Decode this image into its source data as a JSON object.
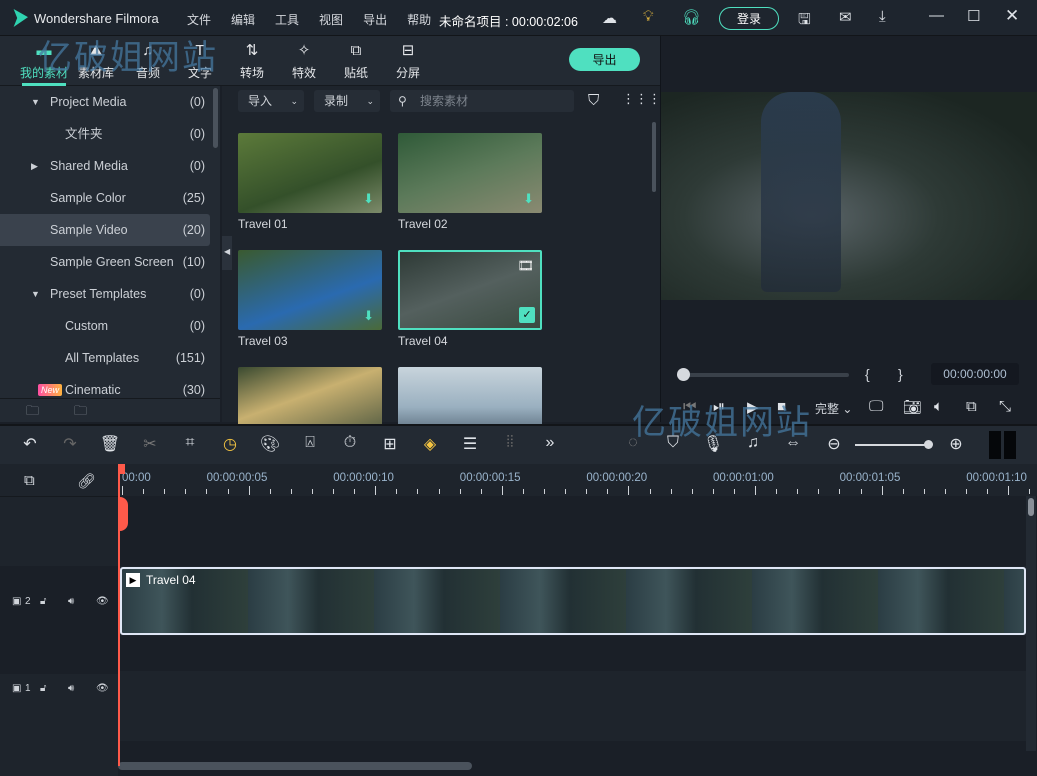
{
  "app": {
    "title": "Wondershare Filmora",
    "project": "未命名项目 : 00:00:02:06",
    "login": "登录"
  },
  "menu": [
    "文件",
    "编辑",
    "工具",
    "视图",
    "导出",
    "帮助"
  ],
  "tabs": [
    {
      "label": "我的素材",
      "icon": "folder-icon"
    },
    {
      "label": "素材库",
      "icon": "stock-icon"
    },
    {
      "label": "音频",
      "icon": "music-icon"
    },
    {
      "label": "文字",
      "icon": "text-icon"
    },
    {
      "label": "转场",
      "icon": "transition-icon"
    },
    {
      "label": "特效",
      "icon": "effects-icon"
    },
    {
      "label": "贴纸",
      "icon": "sticker-icon"
    },
    {
      "label": "分屏",
      "icon": "splitscreen-icon"
    }
  ],
  "export_label": "导出",
  "sidebar": [
    {
      "label": "Project Media",
      "count": "(0)",
      "arrow": "▼",
      "indent": 0
    },
    {
      "label": "文件夹",
      "count": "(0)",
      "arrow": "",
      "indent": 1
    },
    {
      "label": "Shared Media",
      "count": "(0)",
      "arrow": "▶",
      "indent": 0
    },
    {
      "label": "Sample Color",
      "count": "(25)",
      "arrow": "",
      "indent": 0
    },
    {
      "label": "Sample Video",
      "count": "(20)",
      "arrow": "",
      "indent": 0,
      "selected": true
    },
    {
      "label": "Sample Green Screen",
      "count": "(10)",
      "arrow": "",
      "indent": 0
    },
    {
      "label": "Preset Templates",
      "count": "(0)",
      "arrow": "▼",
      "indent": 0
    },
    {
      "label": "Custom",
      "count": "(0)",
      "arrow": "",
      "indent": 1
    },
    {
      "label": "All Templates",
      "count": "(151)",
      "arrow": "",
      "indent": 1
    },
    {
      "label": "Cinematic",
      "count": "(30)",
      "arrow": "",
      "indent": 0,
      "badge": "New"
    }
  ],
  "media_bar": {
    "import": "导入",
    "record": "录制",
    "search_placeholder": "搜索素材"
  },
  "media": [
    {
      "label": "Travel 01"
    },
    {
      "label": "Travel 02"
    },
    {
      "label": "Travel 03"
    },
    {
      "label": "Travel 04",
      "selected": true
    },
    {
      "label": ""
    },
    {
      "label": ""
    }
  ],
  "player": {
    "mark_in": "{",
    "mark_out": "}",
    "time": "00:00:00:00",
    "quality": "完整",
    "progress": 0
  },
  "ruler": [
    "00:00",
    "00:00:00:05",
    "00:00:00:10",
    "00:00:00:15",
    "00:00:00:20",
    "00:00:01:00",
    "00:00:01:05",
    "00:00:01:10"
  ],
  "tracks": [
    {
      "num": "2",
      "clip": "Travel 04"
    },
    {
      "num": "1"
    }
  ],
  "watermark": "亿破姐网站",
  "colors": {
    "accent": "#4fe0c0",
    "playhead": "#ff5a4a",
    "highlight": "#f5c542"
  }
}
